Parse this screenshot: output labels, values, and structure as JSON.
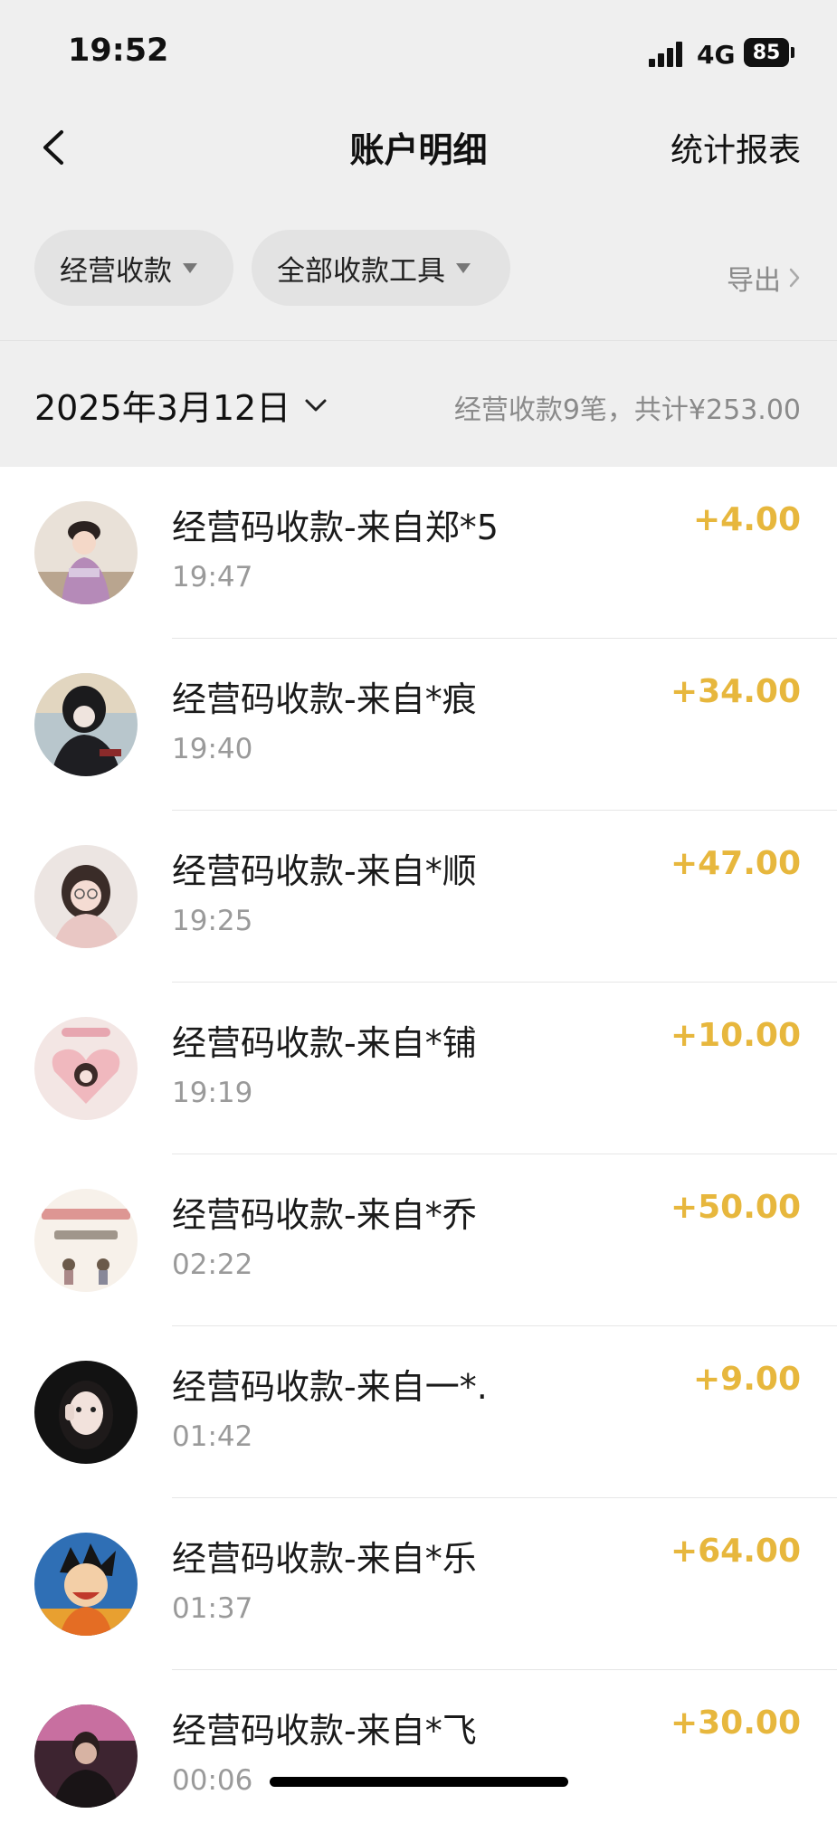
{
  "status_bar": {
    "time": "19:52",
    "network": "4G",
    "battery": "85"
  },
  "nav": {
    "title": "账户明细",
    "right_label": "统计报表"
  },
  "filters": {
    "type_filter": "经营收款",
    "tool_filter": "全部收款工具",
    "export_label": "导出"
  },
  "date_header": {
    "date": "2025年3月12日",
    "summary": "经营收款9笔，共计¥253.00"
  },
  "colors": {
    "amount": "#e7b73d",
    "background_top": "#efefef",
    "secondary_text": "#9a9a9a"
  },
  "transactions": [
    {
      "title": "经营码收款-来自郑*5",
      "time": "19:47",
      "amount": "+4.00"
    },
    {
      "title": "经营码收款-来自*痕",
      "time": "19:40",
      "amount": "+34.00"
    },
    {
      "title": "经营码收款-来自*顺",
      "time": "19:25",
      "amount": "+47.00"
    },
    {
      "title": "经营码收款-来自*铺",
      "time": "19:19",
      "amount": "+10.00"
    },
    {
      "title": "经营码收款-来自*乔",
      "time": "02:22",
      "amount": "+50.00"
    },
    {
      "title": "经营码收款-来自一*.",
      "time": "01:42",
      "amount": "+9.00"
    },
    {
      "title": "经营码收款-来自*乐",
      "time": "01:37",
      "amount": "+64.00"
    },
    {
      "title": "经营码收款-来自*飞",
      "time": "00:06",
      "amount": "+30.00"
    }
  ]
}
